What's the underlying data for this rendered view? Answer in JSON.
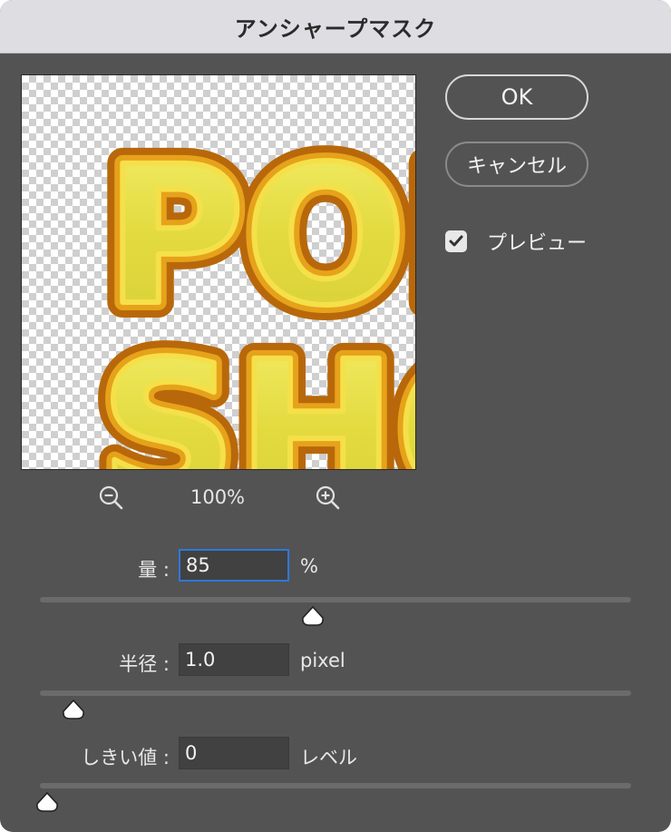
{
  "window": {
    "title": "アンシャープマスク"
  },
  "buttons": {
    "ok": "OK",
    "cancel": "キャンセル"
  },
  "preview_option": {
    "label": "プレビュー",
    "checked": true
  },
  "zoom": {
    "level": "100%",
    "zoom_out_icon": "zoom-out-icon",
    "zoom_in_icon": "zoom-in-icon"
  },
  "fields": {
    "amount": {
      "label": "量 :",
      "value": "85",
      "unit": "%",
      "slider_fraction": 0.46
    },
    "radius": {
      "label": "半径 :",
      "value": "1.0",
      "unit": "pixel",
      "slider_fraction": 0.045
    },
    "threshold": {
      "label": "しきい値 :",
      "value": "0",
      "unit": "レベル",
      "slider_fraction": 0.0
    }
  },
  "preview_image": {
    "text_line_1": "POP",
    "text_line_2": "SHO",
    "fill_color": "#e8e24a",
    "outline_color": "#d08a12"
  },
  "colors": {
    "accent": "#2e78d9",
    "panel": "#535353",
    "titlebar": "#dedde2"
  }
}
